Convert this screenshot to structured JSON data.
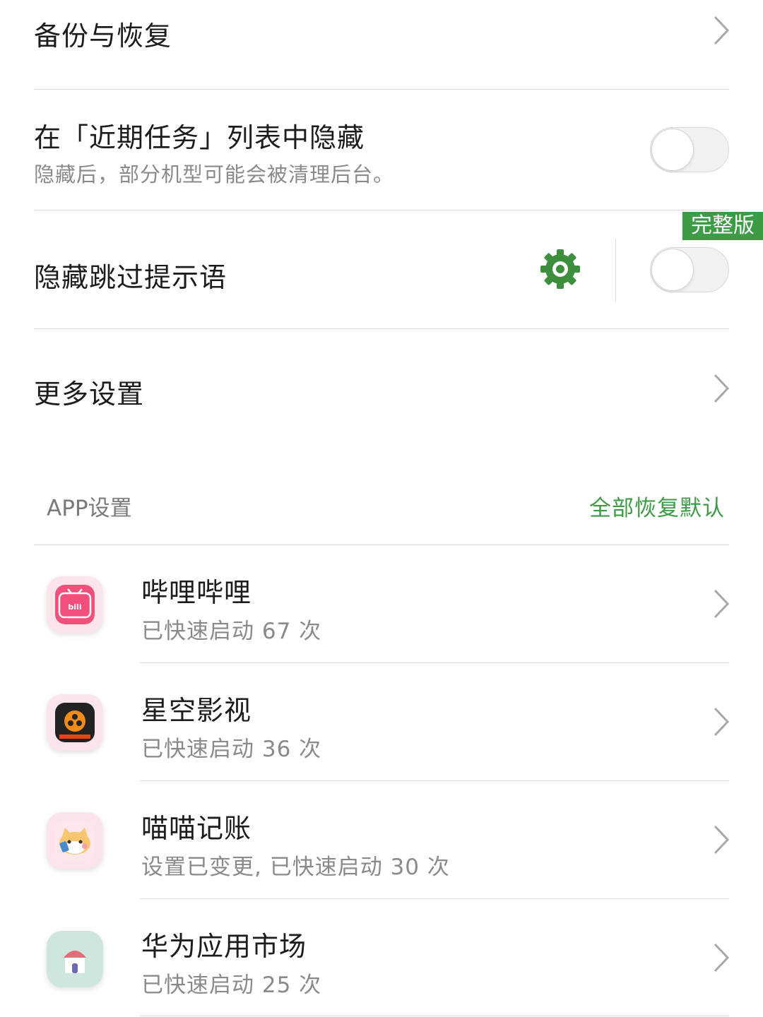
{
  "settings": {
    "backup": {
      "title": "备份与恢复"
    },
    "hide_recent": {
      "title": "在「近期任务」列表中隐藏",
      "subtitle": "隐藏后，部分机型可能会被清理后台。",
      "enabled": false
    },
    "hide_skip_hint": {
      "title": "隐藏跳过提示语",
      "badge": "完整版",
      "enabled": false
    },
    "more": {
      "title": "更多设置"
    }
  },
  "app_section": {
    "title": "APP设置",
    "reset_all": "全部恢复默认"
  },
  "apps": [
    {
      "name": "哔哩哔哩",
      "status": "已快速启动 67 次",
      "icon": "bilibili-icon"
    },
    {
      "name": "星空影视",
      "status": "已快速启动 36 次",
      "icon": "xingkong-icon"
    },
    {
      "name": "喵喵记账",
      "status": "设置已变更, 已快速启动 30 次",
      "icon": "miaomiao-icon"
    },
    {
      "name": "华为应用市场",
      "status": "已快速启动 25 次",
      "icon": "huawei-appgallery-icon"
    }
  ],
  "colors": {
    "accent": "#3d9a45",
    "text_primary": "#1c1c1c",
    "text_secondary": "#8a8a8a",
    "divider": "#dedede"
  }
}
